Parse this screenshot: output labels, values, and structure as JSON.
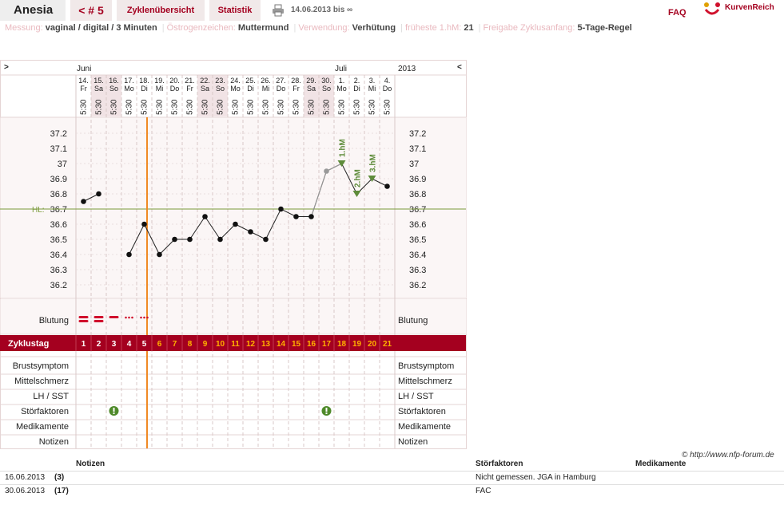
{
  "header": {
    "user": "Anesia",
    "cycle": "< # 5",
    "overview_tab": "Zyklenübersicht",
    "stats_tab": "Statistik",
    "date_range": "14.06.2013 bis ∞",
    "faq": "FAQ",
    "brand": "KurvenReich"
  },
  "info": [
    {
      "label": "Messung:",
      "value": "vaginal / digital / 3 Minuten"
    },
    {
      "label": "Östrogenzeichen:",
      "value": "Muttermund"
    },
    {
      "label": "Verwendung:",
      "value": "Verhütung"
    },
    {
      "label": "früheste 1.hM:",
      "value": "21"
    },
    {
      "label": "Freigabe Zyklusanfang:",
      "value": "5-Tage-Regel"
    }
  ],
  "chart": {
    "nav_left": ">",
    "nav_right": "<",
    "year": "2013",
    "months": [
      {
        "label": "Juni",
        "day_index": 0
      },
      {
        "label": "Juli",
        "day_index": 17
      }
    ],
    "days": [
      {
        "date": "14.",
        "wd": "Fr"
      },
      {
        "date": "15.",
        "wd": "Sa"
      },
      {
        "date": "16.",
        "wd": "So"
      },
      {
        "date": "17.",
        "wd": "Mo"
      },
      {
        "date": "18.",
        "wd": "Di"
      },
      {
        "date": "19.",
        "wd": "Mi"
      },
      {
        "date": "20.",
        "wd": "Do"
      },
      {
        "date": "21.",
        "wd": "Fr"
      },
      {
        "date": "22.",
        "wd": "Sa"
      },
      {
        "date": "23.",
        "wd": "So"
      },
      {
        "date": "24.",
        "wd": "Mo"
      },
      {
        "date": "25.",
        "wd": "Di"
      },
      {
        "date": "26.",
        "wd": "Mi"
      },
      {
        "date": "27.",
        "wd": "Do"
      },
      {
        "date": "28.",
        "wd": "Fr"
      },
      {
        "date": "29.",
        "wd": "Sa"
      },
      {
        "date": "30.",
        "wd": "So"
      },
      {
        "date": "1.",
        "wd": "Mo"
      },
      {
        "date": "2.",
        "wd": "Di"
      },
      {
        "date": "3.",
        "wd": "Mi"
      },
      {
        "date": "4.",
        "wd": "Do"
      }
    ],
    "weekend_indices": [
      1,
      2,
      8,
      9,
      15,
      16
    ],
    "time": "5:30",
    "y_ticks": [
      "37.2",
      "37.1",
      "37",
      "36.9",
      "36.8",
      "36.7",
      "36.6",
      "36.5",
      "36.4",
      "36.3",
      "36.2"
    ],
    "hl_label": "HL:",
    "hl_value": 36.7,
    "temps": [
      36.75,
      36.8,
      null,
      36.4,
      36.6,
      36.4,
      36.5,
      36.5,
      36.65,
      36.5,
      36.6,
      36.55,
      36.5,
      36.7,
      36.65,
      36.65,
      36.95,
      37.0,
      36.8,
      36.9,
      36.85
    ],
    "gray_index": 16,
    "markers": [
      {
        "day_index": 17,
        "label": "1.hM"
      },
      {
        "day_index": 18,
        "label": "2.hM"
      },
      {
        "day_index": 19,
        "label": "3.hM"
      }
    ],
    "bleeding_label": "Blutung",
    "bleeding": [
      {
        "day_index": 0,
        "kind": "heavy"
      },
      {
        "day_index": 1,
        "kind": "heavy"
      },
      {
        "day_index": 2,
        "kind": "medium"
      },
      {
        "day_index": 3,
        "kind": "spot"
      },
      {
        "day_index": 4,
        "kind": "spot"
      }
    ],
    "cycle_day_label": "Zyklustag",
    "cycle_days": [
      "1",
      "2",
      "3",
      "4",
      "5",
      "6",
      "7",
      "8",
      "9",
      "10",
      "11",
      "12",
      "13",
      "14",
      "15",
      "16",
      "17",
      "18",
      "19",
      "20",
      "21"
    ],
    "cycle_release_index": 5,
    "rows": [
      "Brustsymptom",
      "Mittelschmerz",
      "LH / SST",
      "Störfaktoren",
      "Medikamente",
      "Notizen"
    ],
    "disturbances": [
      2,
      16
    ]
  },
  "footer": {
    "copyright": "© http://www.nfp-forum.de",
    "head_notes": "Notizen",
    "head_disturb": "Störfaktoren",
    "head_meds": "Medikamente",
    "rows": [
      {
        "date": "16.06.2013",
        "day": "(3)",
        "disturb": "Nicht gemessen. JGA in Hamburg"
      },
      {
        "date": "30.06.2013",
        "day": "(17)",
        "disturb": "FAC"
      }
    ]
  },
  "colors": {
    "accent": "#a4001f",
    "weekend": "#f1e3e5",
    "hl_line": "#7a9a3a",
    "marker": "#5e8c3a",
    "release_line": "#f08a24",
    "bleeding": "#d0102c"
  }
}
